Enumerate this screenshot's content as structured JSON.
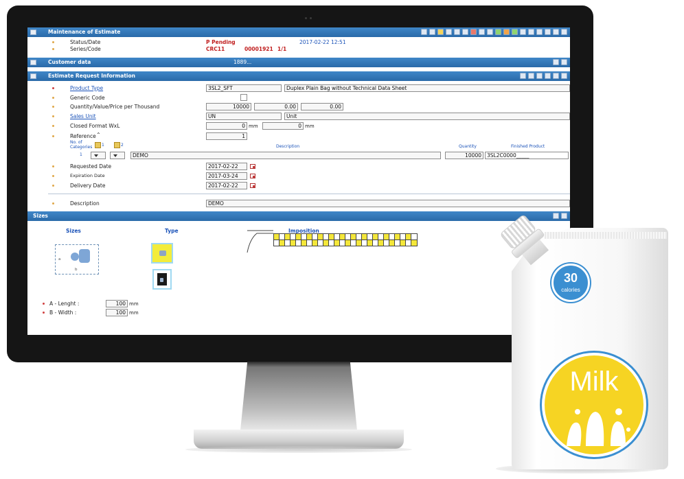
{
  "app": {
    "title_bar": "Maintenance of Estimate",
    "status_label": "Status/Date",
    "status_value": "P Pending",
    "status_date": "2017-02-22 12:51",
    "series_label": "Series/Code",
    "series_value": "CRC11",
    "code_value": "00001921",
    "page_counter": "1/1",
    "customer_bar": "Customer data",
    "customer_center": "1889...",
    "estimate_bar": "Estimate Request Information"
  },
  "form": {
    "product_type_label": "Product Type",
    "product_type_code": "3SL2_SFT",
    "product_type_desc": "Duplex Plain Bag without Technical Data Sheet",
    "generic_code_label": "Generic Code",
    "qvp_label": "Quantity/Value/Price per Thousand",
    "quantity": "10000",
    "value": "0.00",
    "price": "0.00",
    "sales_unit_label": "Sales Unit",
    "sales_unit_code": "UN",
    "sales_unit_name": "Unit",
    "closed_format_label": "Closed Format WxL",
    "closed_w": "0",
    "closed_l": "0",
    "mm_unit": "mm",
    "reference_label": "Reference",
    "reference_value": "1",
    "categories_label": "No. of Categories",
    "cat_1": "1",
    "cat_2": "2",
    "col_description": "Description",
    "col_quantity": "Quantity",
    "col_finished": "Finished Product",
    "line_no": "1",
    "line_description": "DEMO",
    "line_quantity": "10000",
    "line_finished": "3SL2C0000_____",
    "requested_date_label": "Requested Date",
    "requested_date": "2017-02-22",
    "expiration_date_label": "Expiration Date",
    "expiration_date": "2017-03-24",
    "delivery_date_label": "Delivery Date",
    "delivery_date": "2017-02-22",
    "description_label": "Description",
    "description_value": "DEMO"
  },
  "sizes": {
    "bar_title": "Sizes",
    "col_sizes": "Sizes",
    "col_type": "Type",
    "col_imposition": "Imposition",
    "a_label": "A - Lenght :",
    "a_value": "100",
    "b_label": "B - Width :",
    "b_value": "100",
    "unit": "mm",
    "dim_a": "a",
    "dim_b": "b"
  },
  "pouch": {
    "calories_number": "30",
    "calories_word": "calories",
    "brand": "Milk"
  },
  "colors": {
    "bar_blue": "#2f73b5",
    "link_blue": "#1a52b8",
    "pending_red": "#c01e1e",
    "pouch_yellow": "#f6d423",
    "pouch_blue": "#3b8fd1"
  }
}
